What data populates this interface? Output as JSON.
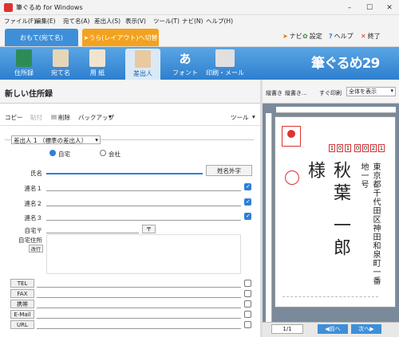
{
  "window": {
    "title": "筆ぐるめ for Windows",
    "min": "–",
    "max": "☐",
    "close": "✕"
  },
  "menu": [
    "ファイル(F)",
    "編集(E)",
    "宛て名(A)",
    "差出人(S)",
    "表示(V)",
    "ツール(T)",
    "ナビ(N)",
    "ヘルプ(H)"
  ],
  "mode": {
    "front": "おもて(宛て名)",
    "back": "うら(レイアウト)へ切替",
    "back_arrow": "➤"
  },
  "topbuttons": {
    "navi": "ナビ",
    "settings": "設定",
    "help": "ヘルプ",
    "exit": "終了"
  },
  "tools": [
    "住所録",
    "宛て名",
    "用 紙",
    "差出人",
    "フォント",
    "印刷・メール"
  ],
  "font_icon_text": "あ",
  "brand": "筆ぐるめ29",
  "left": {
    "list_title": "新しい住所録"
  },
  "editbar": {
    "copy": "コピー",
    "paste": "貼付",
    "delete": "削除",
    "backup": "バックアップ",
    "tools": "ツール"
  },
  "form": {
    "sender_select": "差出人 1 （標準の差出人）",
    "radio_home": "自宅",
    "radio_company": "会社",
    "name_label": "氏名",
    "name_value": "",
    "external_button": "姓名外字",
    "joint": [
      "連名１",
      "連名２",
      "連名３"
    ],
    "postal_label": "自宅〒",
    "postal_button": "〒",
    "address_label": "自宅住所",
    "newline_button": "改行",
    "contacts": [
      "TEL",
      "FAX",
      "携帯",
      "E-Mail",
      "URL"
    ]
  },
  "right": {
    "tab1": "縦書き",
    "tab2": "縦書き...",
    "print_label": "すぐ印刷",
    "view_select": "全体を表示",
    "page": "1/1",
    "prev": "前へ",
    "next": "次へ"
  },
  "card": {
    "postal": [
      "1",
      "0",
      "1",
      "0",
      "0",
      "2",
      "1"
    ],
    "recipient": "秋葉 一郎 様",
    "address": "東京都千代田区神田和泉町一番地一号"
  },
  "colors": {
    "blue": "#2d7fcf",
    "orange": "#f3a21f",
    "accent": "#2f7fd6",
    "red": "#d33"
  }
}
